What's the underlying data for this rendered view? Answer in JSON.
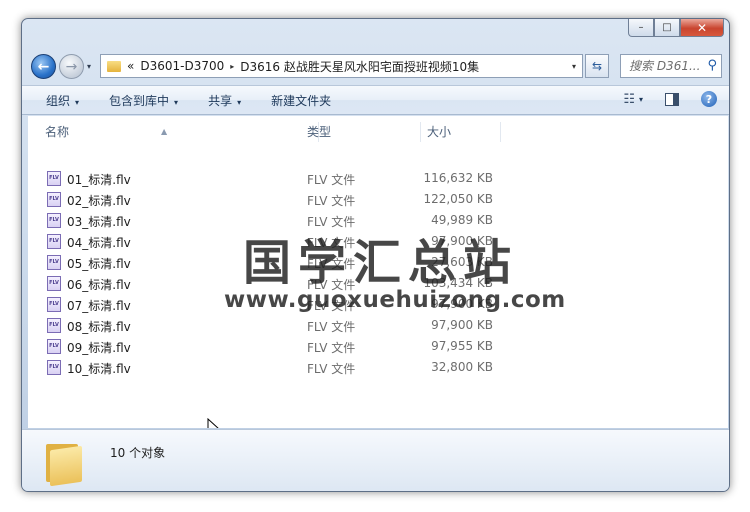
{
  "window": {
    "controls": {
      "minimize": "–",
      "maximize": "□",
      "close": "✕"
    }
  },
  "nav": {
    "back_glyph": "←",
    "forward_glyph": "→",
    "dropdown_glyph": "▾"
  },
  "address": {
    "overflow": "«",
    "crumbs": [
      "D3601-D3700",
      "D3616 赵战胜天星风水阳宅面授班视频10集"
    ],
    "separator": "▸",
    "dropdown_glyph": "▾"
  },
  "refresh_glyph": "⇆",
  "search": {
    "placeholder": "搜索 D361..."
  },
  "toolbar": {
    "organize": "组织",
    "include_in_library": "包含到库中",
    "share": "共享",
    "new_folder": "新建文件夹",
    "dropdown_glyph": "▾",
    "help": "?"
  },
  "columns": {
    "name": "名称",
    "type": "类型",
    "size": "大小"
  },
  "files": [
    {
      "name": "01_标清.flv",
      "type": "FLV 文件",
      "size": "116,632 KB"
    },
    {
      "name": "02_标清.flv",
      "type": "FLV 文件",
      "size": "122,050 KB"
    },
    {
      "name": "03_标清.flv",
      "type": "FLV 文件",
      "size": "49,989 KB"
    },
    {
      "name": "04_标清.flv",
      "type": "FLV 文件",
      "size": "97,900 KB"
    },
    {
      "name": "05_标清.flv",
      "type": "FLV 文件",
      "size": "27,603 KB"
    },
    {
      "name": "06_标清.flv",
      "type": "FLV 文件",
      "size": "103,434 KB"
    },
    {
      "name": "07_标清.flv",
      "type": "FLV 文件",
      "size": "97,900 KB"
    },
    {
      "name": "08_标清.flv",
      "type": "FLV 文件",
      "size": "97,900 KB"
    },
    {
      "name": "09_标清.flv",
      "type": "FLV 文件",
      "size": "97,955 KB"
    },
    {
      "name": "10_标清.flv",
      "type": "FLV 文件",
      "size": "32,800 KB"
    }
  ],
  "file_icon_label": "FLV",
  "watermark": {
    "chinese": "国学汇总站",
    "url": "www.guoxuehuizong.com"
  },
  "status": {
    "item_count": "10 个对象"
  },
  "colors": {
    "accent": "#2a72c9",
    "close": "#c9452f",
    "folder": "#ebc15a"
  }
}
